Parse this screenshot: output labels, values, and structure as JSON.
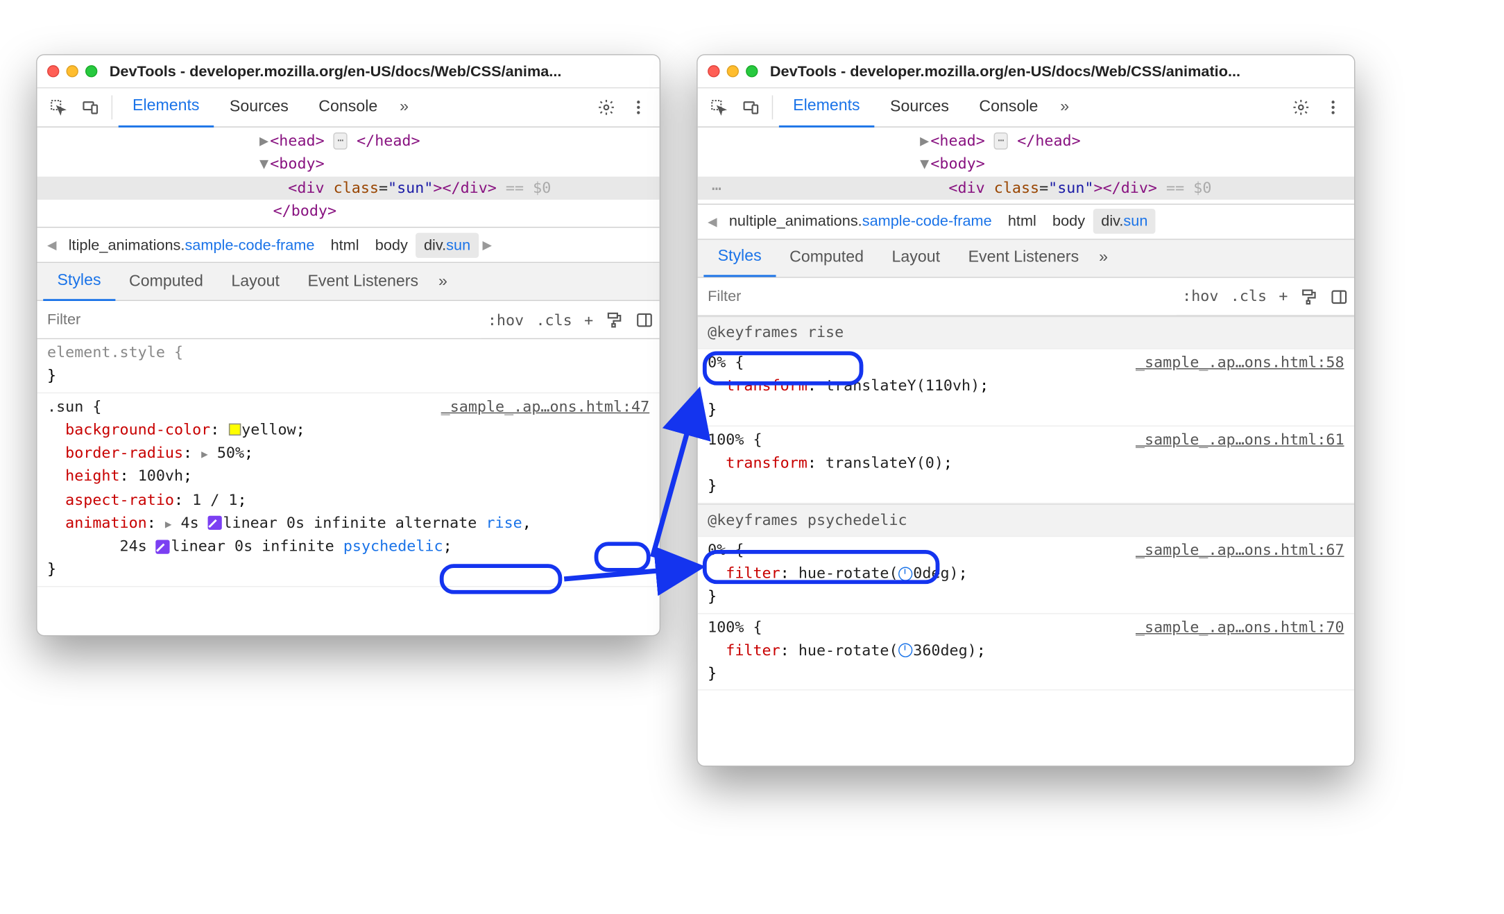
{
  "left": {
    "title": "DevTools - developer.mozilla.org/en-US/docs/Web/CSS/anima...",
    "tabs": {
      "elements": "Elements",
      "sources": "Sources",
      "console": "Console"
    },
    "dom": {
      "head_open": "<head>",
      "head_close": "</head>",
      "body_open": "<body>",
      "body_close": "</body>",
      "div_tag": "div",
      "class_attr": "class",
      "class_val": "\"sun\"",
      "eqdollar": "== $0"
    },
    "crumbs": {
      "c1_pre": "ltiple_animations.",
      "c1_blue": "sample-code-frame",
      "c2": "html",
      "c3": "body",
      "c4_pre": "div.",
      "c4_blue": "sun"
    },
    "subtabs": {
      "styles": "Styles",
      "computed": "Computed",
      "layout": "Layout",
      "events": "Event Listeners"
    },
    "filter_placeholder": "Filter",
    "filter_tools": {
      "hov": ":hov",
      "cls": ".cls"
    },
    "rules": {
      "element_style": "element.style {",
      "sun_selector": ".sun {",
      "sun_src": "_sample_.ap…ons.html:47",
      "bgcolor_p": "background-color",
      "bgcolor_v": "yellow",
      "bradius_p": "border-radius",
      "bradius_v": "50%",
      "height_p": "height",
      "height_v": "100vh",
      "aspect_p": "aspect-ratio",
      "aspect_v": "1 / 1",
      "anim_p": "animation",
      "anim1_dur": "4s",
      "anim1_timing": "linear 0s infinite alternate",
      "anim1_name": "rise",
      "anim2_dur": "24s",
      "anim2_timing": "linear 0s infinite",
      "anim2_name": "psychedelic",
      "close": "}"
    }
  },
  "right": {
    "title": "DevTools - developer.mozilla.org/en-US/docs/Web/CSS/animatio...",
    "tabs": {
      "elements": "Elements",
      "sources": "Sources",
      "console": "Console"
    },
    "dom": {
      "head_open": "<head>",
      "head_close": "</head>",
      "body_open": "<body>",
      "body_close": "</body>",
      "div_tag": "div",
      "class_attr": "class",
      "class_val": "\"sun\"",
      "eqdollar": "== $0"
    },
    "crumbs": {
      "c1_pre": "nultiple_animations.",
      "c1_blue": "sample-code-frame",
      "c2": "html",
      "c3": "body",
      "c4_pre": "div.",
      "c4_blue": "sun"
    },
    "subtabs": {
      "styles": "Styles",
      "computed": "Computed",
      "layout": "Layout",
      "events": "Event Listeners"
    },
    "filter_placeholder": "Filter",
    "filter_tools": {
      "hov": ":hov",
      "cls": ".cls"
    },
    "keyframes": {
      "rise_header": "@keyframes rise",
      "rise0_sel": "0% {",
      "rise0_src": "_sample_.ap…ons.html:58",
      "rise0_p": "transform",
      "rise0_v": "translateY(110vh)",
      "rise100_sel": "100% {",
      "rise100_src": "_sample_.ap…ons.html:61",
      "rise100_p": "transform",
      "rise100_v": "translateY(0)",
      "psy_header": "@keyframes psychedelic",
      "psy0_sel": "0% {",
      "psy0_src": "_sample_.ap…ons.html:67",
      "psy0_p": "filter",
      "psy0_v": "hue-rotate(",
      "psy0_v2": "0deg)",
      "psy100_sel": "100% {",
      "psy100_src": "_sample_.ap…ons.html:70",
      "psy100_p": "filter",
      "psy100_v": "hue-rotate(",
      "psy100_v2": "360deg)",
      "close": "}"
    }
  }
}
